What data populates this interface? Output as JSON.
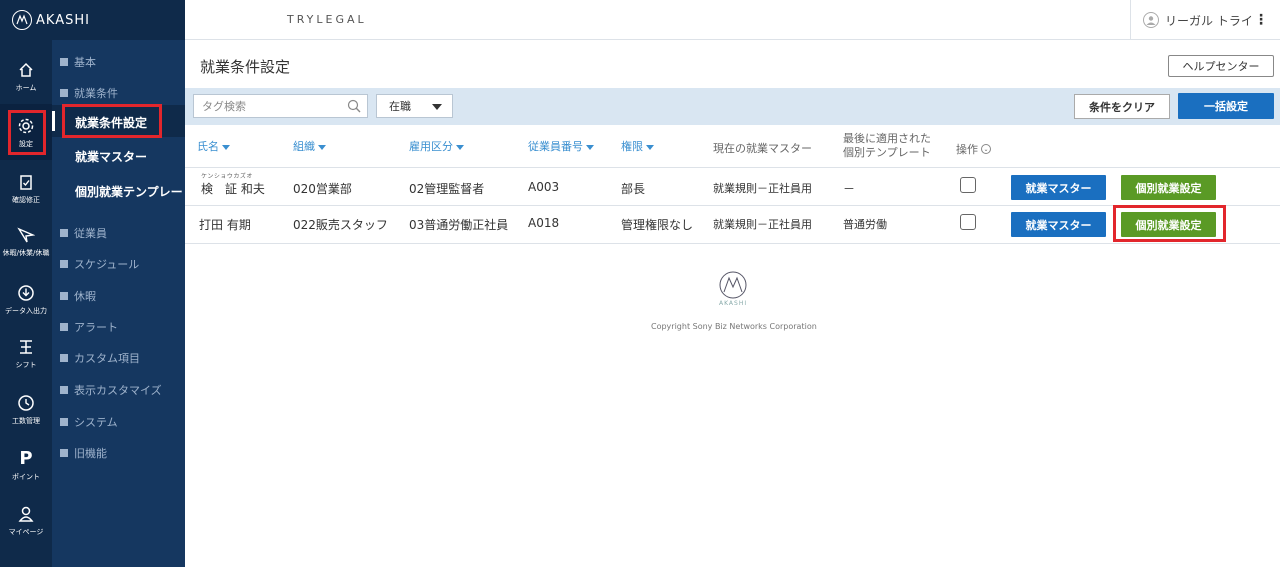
{
  "brand": {
    "name": "AKASHI"
  },
  "topbar": {
    "company": "TRYLEGAL",
    "user_name": "リーガル トライ",
    "menu_glyph": "⋮"
  },
  "rail": [
    {
      "label": "ホーム",
      "icon": "home-icon"
    },
    {
      "label": "設定",
      "icon": "gear-icon"
    },
    {
      "label": "確認修正",
      "icon": "clipboard-icon"
    },
    {
      "label": "休暇/休業/休職",
      "icon": "paper-plane-icon"
    },
    {
      "label": "データ入出力",
      "icon": "download-icon"
    },
    {
      "label": "シフト",
      "icon": "shift-icon"
    },
    {
      "label": "工数管理",
      "icon": "clock-icon"
    },
    {
      "label": "ポイント",
      "icon": "point-icon",
      "glyph": "P"
    },
    {
      "label": "マイページ",
      "icon": "user-icon"
    }
  ],
  "submenu": {
    "groups": [
      "基本",
      "就業条件",
      "従業員",
      "スケジュール",
      "休暇",
      "アラート",
      "カスタム項目",
      "表示カスタマイズ",
      "システム",
      "旧機能"
    ],
    "items": [
      "就業条件設定",
      "就業マスター",
      "個別就業テンプレート"
    ]
  },
  "page": {
    "title": "就業条件設定",
    "help_label": "ヘルプセンター"
  },
  "filter": {
    "tag_placeholder": "タグ検索",
    "status_value": "在職",
    "clear_label": "条件をクリア",
    "bulk_label": "一括設定"
  },
  "table": {
    "headers": {
      "name": "氏名",
      "org": "組織",
      "employment": "雇用区分",
      "emp_no": "従業員番号",
      "permission": "権限",
      "current_master": "現在の就業マスター",
      "last_template_1": "最後に適用された",
      "last_template_2": "個別テンプレート",
      "operation": "操作",
      "operation_glyph": "⌄"
    },
    "rows": [
      {
        "kana": "ケンショウカズオ",
        "name": "検　証 和夫",
        "org": "020営業部",
        "employment": "02管理監督者",
        "emp_no": "A003",
        "permission": "部長",
        "master": "就業規則－正社員用",
        "template": "－",
        "btn_master": "就業マスター",
        "btn_individual": "個別就業設定"
      },
      {
        "kana": "",
        "name": "打田 有期",
        "org": "022販売スタッフ",
        "employment": "03普通労働正社員",
        "emp_no": "A018",
        "permission": "管理権限なし",
        "master": "就業規則－正社員用",
        "template": "普通労働",
        "btn_master": "就業マスター",
        "btn_individual": "個別就業設定"
      }
    ]
  },
  "footer": {
    "logo_text": "AKASHI",
    "copyright": "Copyright Sony Biz Networks Corporation"
  },
  "colors": {
    "accent_blue": "#1a6fc0",
    "accent_green": "#5a9a25",
    "highlight_red": "#e2262c",
    "nav_dark": "#0f2a4a"
  }
}
